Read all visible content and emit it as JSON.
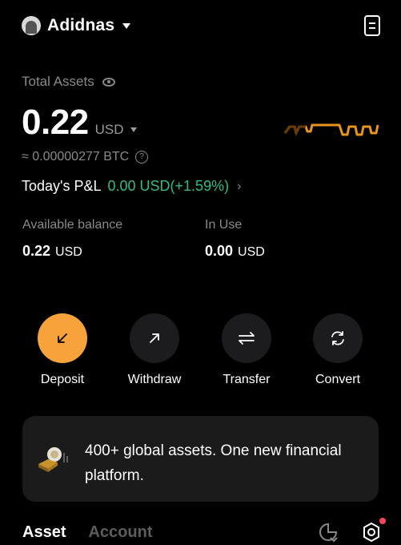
{
  "header": {
    "account_name": "Adidnas"
  },
  "total_assets": {
    "label": "Total Assets",
    "value": "0.22",
    "currency": "USD",
    "btc_equivalent": "≈ 0.00000277 BTC"
  },
  "pnl": {
    "label": "Today's P&L",
    "value": "0.00 USD(+1.59%)",
    "color": "#2ebd85"
  },
  "available_balance": {
    "label": "Available balance",
    "value": "0.22",
    "unit": "USD"
  },
  "in_use": {
    "label": "In Use",
    "value": "0.00",
    "unit": "USD"
  },
  "actions": [
    {
      "label": "Deposit",
      "icon": "arrow-down-left-icon",
      "color": "#f7a23b"
    },
    {
      "label": "Withdraw",
      "icon": "arrow-up-right-icon"
    },
    {
      "label": "Transfer",
      "icon": "transfer-arrows-icon"
    },
    {
      "label": "Convert",
      "icon": "refresh-icon"
    }
  ],
  "promo": {
    "text": "400+ global assets. One new financial platform."
  },
  "tabs": [
    {
      "label": "Asset",
      "active": true
    },
    {
      "label": "Account",
      "active": false
    }
  ],
  "colors": {
    "accent": "#f7a23b",
    "positive": "#2ebd85",
    "background": "#000000",
    "card": "#1b1b1b",
    "notification": "#f6465d"
  }
}
